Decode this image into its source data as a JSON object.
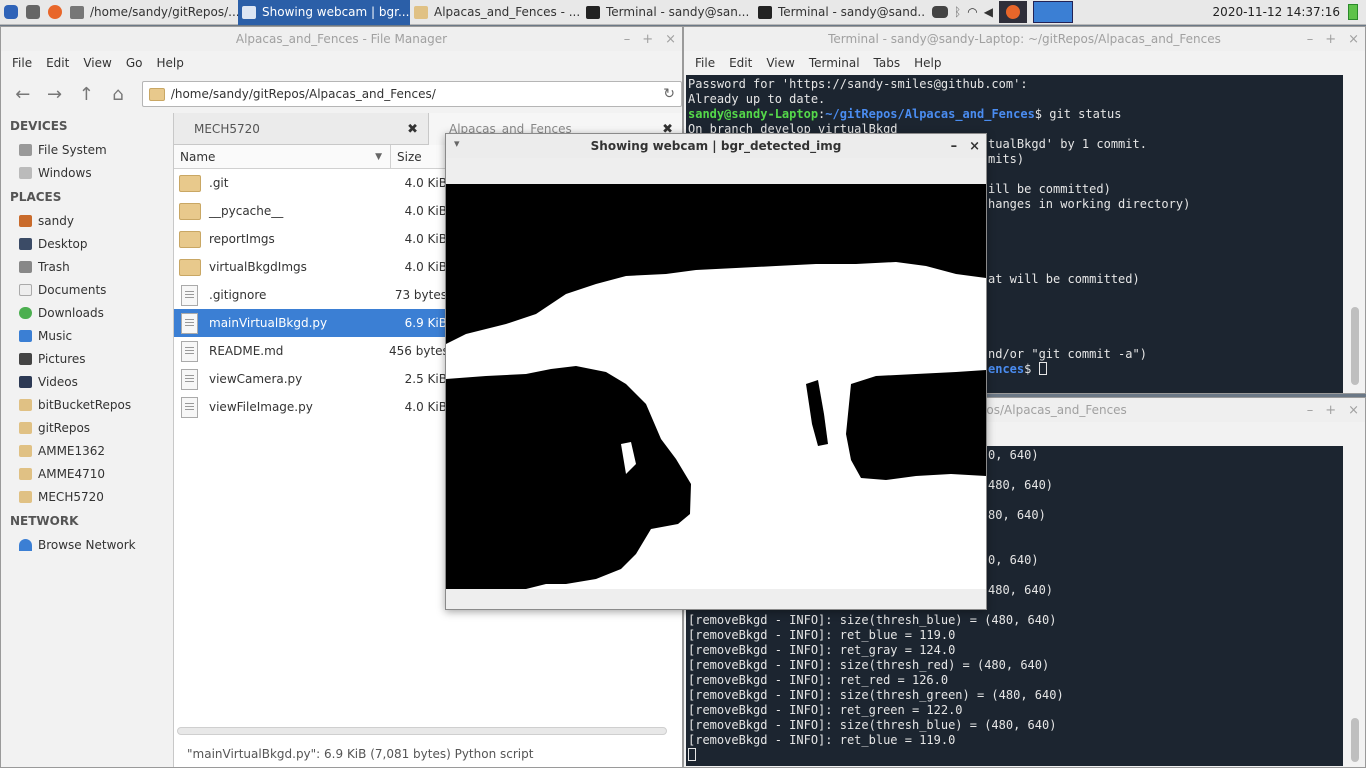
{
  "panel": {
    "tasks": [
      {
        "label": "/home/sandy/gitRepos/..."
      },
      {
        "label": "Showing webcam | bgr..."
      },
      {
        "label": "Alpacas_and_Fences - ..."
      },
      {
        "label": "Terminal - sandy@san..."
      },
      {
        "label": "Terminal - sandy@sand..."
      }
    ],
    "clock": "2020-11-12 14:37:16"
  },
  "file_manager": {
    "title": "Alpacas_and_Fences - File Manager",
    "menu": [
      "File",
      "Edit",
      "View",
      "Go",
      "Help"
    ],
    "path": "/home/sandy/gitRepos/Alpacas_and_Fences/",
    "sidebar": {
      "devices_heading": "DEVICES",
      "devices": [
        "File System",
        "Windows"
      ],
      "places_heading": "PLACES",
      "places": [
        "sandy",
        "Desktop",
        "Trash",
        "Documents",
        "Downloads",
        "Music",
        "Pictures",
        "Videos",
        "bitBucketRepos",
        "gitRepos",
        "AMME1362",
        "AMME4710",
        "MECH5720"
      ],
      "network_heading": "NETWORK",
      "network": [
        "Browse Network"
      ]
    },
    "tabs": [
      {
        "label": "MECH5720",
        "close": "✖"
      },
      {
        "label": "Alpacas_and_Fences",
        "close": "✖"
      }
    ],
    "columns": {
      "name": "Name",
      "size": "Size"
    },
    "files": [
      {
        "name": ".git",
        "size": "4.0 KiB",
        "type": "folder"
      },
      {
        "name": "__pycache__",
        "size": "4.0 KiB",
        "type": "folder"
      },
      {
        "name": "reportImgs",
        "size": "4.0 KiB",
        "type": "folder"
      },
      {
        "name": "virtualBkgdImgs",
        "size": "4.0 KiB",
        "type": "folder"
      },
      {
        "name": ".gitignore",
        "size": "73 bytes",
        "type": "file"
      },
      {
        "name": "mainVirtualBkgd.py",
        "size": "6.9 KiB",
        "type": "file"
      },
      {
        "name": "README.md",
        "size": "456 bytes",
        "type": "file"
      },
      {
        "name": "viewCamera.py",
        "size": "2.5 KiB",
        "type": "file"
      },
      {
        "name": "viewFileImage.py",
        "size": "4.0 KiB",
        "type": "file"
      }
    ],
    "selected_file": "mainVirtualBkgd.py",
    "status": "\"mainVirtualBkgd.py\": 6.9 KiB (7,081 bytes) Python script"
  },
  "terminal1": {
    "title": "Terminal - sandy@sandy-Laptop: ~/gitRepos/Alpacas_and_Fences",
    "menu": [
      "File",
      "Edit",
      "View",
      "Terminal",
      "Tabs",
      "Help"
    ],
    "line_password": "Password for 'https://sandy-smiles@github.com':",
    "line_uptodate": "Already up to date.",
    "prompt_user": "sandy@sandy-Laptop",
    "prompt_path": "~/gitRepos/Alpacas_and_Fences",
    "command": "$ git status",
    "line_branch": "On branch develop_virtualBkgd",
    "line_ahead": "tualBkgd' by 1 commit.",
    "line_commits": "mits)",
    "line_committed": "ill be committed)",
    "line_changes": "hanges in working directory)",
    "line_will_commit": "at will be committed)",
    "line_andor": "nd/or \"git commit -a\")",
    "line_prompt_tail": "ences",
    "line_prompt_tail_sym": "$"
  },
  "terminal2": {
    "title": "p:~/gitRepos/Alpacas_and_Fences",
    "partial_lines": [
      "0, 640)",
      "480, 640)",
      "80, 640)",
      "0, 640)",
      "480, 640)"
    ],
    "lines": [
      "[removeBkgd - INFO]: size(thresh_blue) = (480, 640)",
      "[removeBkgd - INFO]: ret_blue = 119.0",
      "[removeBkgd - INFO]: ret_gray = 124.0",
      "[removeBkgd - INFO]: size(thresh_red) = (480, 640)",
      "[removeBkgd - INFO]: ret_red = 126.0",
      "[removeBkgd - INFO]: size(thresh_green) = (480, 640)",
      "[removeBkgd - INFO]: ret_green = 122.0",
      "[removeBkgd - INFO]: size(thresh_blue) = (480, 640)",
      "[removeBkgd - INFO]: ret_blue = 119.0"
    ]
  },
  "webcam": {
    "title": "Showing webcam | bgr_detected_img"
  }
}
